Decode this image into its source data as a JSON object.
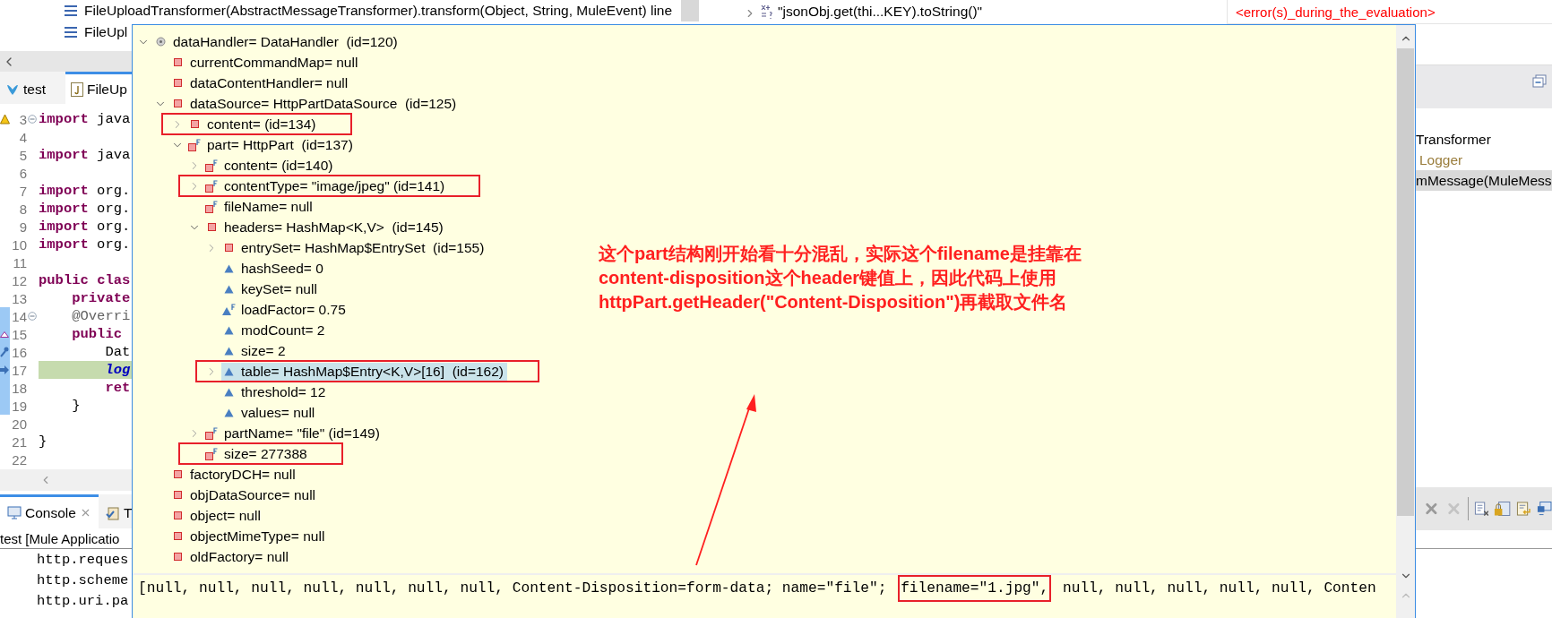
{
  "debug_stack": {
    "frames": [
      {
        "text": "FileUploadTransformer(AbstractMessageTransformer).transform(Object, String, MuleEvent) line"
      },
      {
        "text": "FileUpl"
      }
    ]
  },
  "expression": {
    "text": "\"jsonObj.get(thi...KEY).toString()\"",
    "value": "<error(s)_during_the_evaluation>"
  },
  "editor": {
    "tabs": [
      {
        "label": "test",
        "kind": "mule",
        "selected": false
      },
      {
        "label": "FileUp",
        "kind": "java",
        "selected": true
      }
    ],
    "lines": [
      {
        "number": "3",
        "text": "**import** java",
        "fold": true,
        "gutter": {
          "kind": "warning"
        }
      },
      {
        "number": "4"
      },
      {
        "number": "5",
        "text": "**import** java"
      },
      {
        "number": "6"
      },
      {
        "number": "7",
        "text": "**import** org."
      },
      {
        "number": "8",
        "text": "**import** org."
      },
      {
        "number": "9",
        "text": "**import** org."
      },
      {
        "number": "10",
        "text": "**import** org."
      },
      {
        "number": "11"
      },
      {
        "number": "12",
        "text": "**public** **clas**"
      },
      {
        "number": "13",
        "text": "    **private**"
      },
      {
        "number": "14",
        "text": "    @Overri",
        "kind": "annotation",
        "fold": true,
        "in_range": true
      },
      {
        "number": "15",
        "text": "    **public**",
        "gutter": {
          "kind": "override"
        },
        "in_range": true
      },
      {
        "number": "16",
        "text": "        Dat",
        "gutter": {
          "kind": "pin"
        },
        "in_range": true
      },
      {
        "number": "17",
        "text": "        log",
        "kind": "field",
        "gutter": {
          "kind": "pointer"
        },
        "current": true,
        "in_range": true
      },
      {
        "number": "18",
        "text": "        **ret**",
        "in_range": true
      },
      {
        "number": "19",
        "text": "    }",
        "in_range": true
      },
      {
        "number": "20"
      },
      {
        "number": "21",
        "text": "}"
      },
      {
        "number": "22"
      }
    ]
  },
  "console": {
    "tabs": [
      {
        "label": "Console",
        "kind": "console",
        "selected": true,
        "closable": true
      },
      {
        "label": "T",
        "kind": "tasks",
        "selected": false
      }
    ],
    "title": "test [Mule Applicatio",
    "lines": [
      "http.reques",
      "http.scheme",
      "http.uri.pa"
    ]
  },
  "outline": {
    "items": [
      {
        "text": "Transformer",
        "kind": "type",
        "selected": false
      },
      {
        "text": "Logger",
        "kind": "field",
        "selected": false
      },
      {
        "text": "mMessage(MuleMess",
        "kind": "method",
        "selected": true
      }
    ]
  },
  "inspect_popup": {
    "tree": [
      {
        "label": "dataHandler= DataHandler  (id=120)",
        "kind": "local",
        "expanded": true,
        "selected": false,
        "children": [
          {
            "label": "currentCommandMap= null",
            "kind": "private",
            "selected": false
          },
          {
            "label": "dataContentHandler= null",
            "kind": "private",
            "selected": false
          },
          {
            "label": "dataSource= HttpPartDataSource  (id=125)",
            "kind": "private",
            "expanded": true,
            "selected": false,
            "children": [
              {
                "label": "content= (id=134)",
                "kind": "private",
                "expanded": false,
                "selected": false,
                "boxed": true
              },
              {
                "label": "part= HttpPart  (id=137)",
                "kind": "private-final",
                "expanded": true,
                "selected": false,
                "children": [
                  {
                    "label": "content= (id=140)",
                    "kind": "private-final",
                    "expanded": false,
                    "selected": false
                  },
                  {
                    "label": "contentType= \"image/jpeg\" (id=141)",
                    "kind": "private-final",
                    "expanded": false,
                    "selected": false,
                    "boxed": true
                  },
                  {
                    "label": "fileName= null",
                    "kind": "private-final",
                    "selected": false
                  },
                  {
                    "label": "headers= HashMap<K,V>  (id=145)",
                    "kind": "private",
                    "expanded": true,
                    "selected": false,
                    "children": [
                      {
                        "label": "entrySet= HashMap$EntrySet  (id=155)",
                        "kind": "private",
                        "expanded": false,
                        "selected": false
                      },
                      {
                        "label": "hashSeed= 0",
                        "kind": "package",
                        "selected": false
                      },
                      {
                        "label": "keySet= null",
                        "kind": "package",
                        "selected": false
                      },
                      {
                        "label": "loadFactor= 0.75",
                        "kind": "package-final",
                        "selected": false
                      },
                      {
                        "label": "modCount= 2",
                        "kind": "package",
                        "selected": false
                      },
                      {
                        "label": "size= 2",
                        "kind": "package",
                        "selected": false
                      },
                      {
                        "label": "table= HashMap$Entry<K,V>[16]  (id=162)",
                        "kind": "package",
                        "expanded": false,
                        "selected": true,
                        "boxed": true
                      },
                      {
                        "label": "threshold= 12",
                        "kind": "package",
                        "selected": false
                      },
                      {
                        "label": "values= null",
                        "kind": "package",
                        "selected": false
                      }
                    ]
                  },
                  {
                    "label": "partName= \"file\" (id=149)",
                    "kind": "private-final",
                    "expanded": false,
                    "selected": false
                  },
                  {
                    "label": "size= 277388",
                    "kind": "private-final",
                    "selected": false,
                    "boxed": true
                  }
                ]
              }
            ]
          },
          {
            "label": "factoryDCH= null",
            "kind": "private",
            "selected": false
          },
          {
            "label": "objDataSource= null",
            "kind": "private",
            "selected": false
          },
          {
            "label": "object= null",
            "kind": "private",
            "selected": false
          },
          {
            "label": "objectMimeType= null",
            "kind": "private",
            "selected": false
          },
          {
            "label": "oldFactory= null",
            "kind": "private",
            "selected": false
          }
        ]
      }
    ],
    "detail": [
      {
        "text": "[null, null, null, null, null, null, null, Content-Disposition=form-data; name=\"file\"; ",
        "boxed": false
      },
      {
        "text": "filename=\"1.jpg\",",
        "boxed": true
      },
      {
        "text": " null, null, null, null, null, Conten",
        "boxed": false
      }
    ]
  },
  "annotation": {
    "lines": [
      "这个part结构刚开始看十分混乱，实际这个filename是挂靠在",
      "content-disposition这个header键值上，因此代码上使用",
      "httpPart.getHeader(\"Content-Disposition\")再截取文件名"
    ]
  }
}
